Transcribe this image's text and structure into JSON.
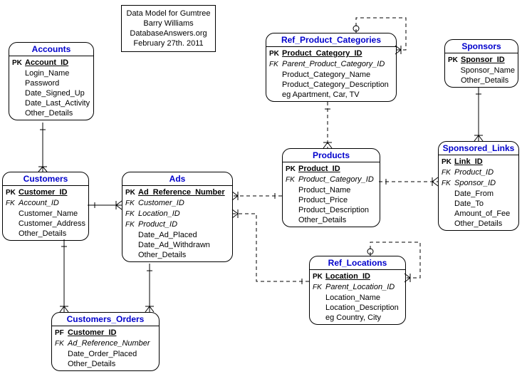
{
  "info": {
    "line1": "Data Model for Gumtree",
    "line2": "Barry Williams",
    "line3": "DatabaseAnswers.org",
    "line4": "February 27th. 2011"
  },
  "entities": {
    "accounts": {
      "title": "Accounts",
      "attrs": [
        {
          "key": "PK",
          "name": "Account_ID",
          "pk": true
        },
        {
          "key": "",
          "name": "Login_Name"
        },
        {
          "key": "",
          "name": "Password"
        },
        {
          "key": "",
          "name": "Date_Signed_Up"
        },
        {
          "key": "",
          "name": "Date_Last_Activity"
        },
        {
          "key": "",
          "name": "Other_Details"
        }
      ]
    },
    "customers": {
      "title": "Customers",
      "attrs": [
        {
          "key": "PK",
          "name": "Customer_ID",
          "pk": true
        },
        {
          "key": "FK",
          "name": "Account_ID",
          "fk": true
        },
        {
          "key": "",
          "name": "Customer_Name"
        },
        {
          "key": "",
          "name": "Customer_Address"
        },
        {
          "key": "",
          "name": "Other_Details"
        }
      ]
    },
    "ads": {
      "title": "Ads",
      "attrs": [
        {
          "key": "PK",
          "name": "Ad_Reference_Number",
          "pk": true
        },
        {
          "key": "FK",
          "name": "Customer_ID",
          "fk": true
        },
        {
          "key": "FK",
          "name": "Location_ID",
          "fk": true
        },
        {
          "key": "FK",
          "name": "Product_ID",
          "fk": true
        },
        {
          "key": "",
          "name": "Date_Ad_Placed"
        },
        {
          "key": "",
          "name": "Date_Ad_Withdrawn"
        },
        {
          "key": "",
          "name": "Other_Details"
        }
      ]
    },
    "customers_orders": {
      "title": "Customers_Orders",
      "attrs": [
        {
          "key": "PF",
          "name": "Customer_ID",
          "pk": true
        },
        {
          "key": "FK",
          "name": "Ad_Reference_Number",
          "fk": true
        },
        {
          "key": "",
          "name": "Date_Order_Placed"
        },
        {
          "key": "",
          "name": "Other_Details"
        }
      ]
    },
    "ref_product_categories": {
      "title": "Ref_Product_Categories",
      "attrs": [
        {
          "key": "PK",
          "name": "Product_Category_ID",
          "pk": true
        },
        {
          "key": "FK",
          "name": "Parent_Product_Category_ID",
          "fk": true
        },
        {
          "key": "",
          "name": "Product_Category_Name"
        },
        {
          "key": "",
          "name": "Product_Category_Description"
        },
        {
          "key": "",
          "name": "eg Apartment, Car, TV"
        }
      ]
    },
    "products": {
      "title": "Products",
      "attrs": [
        {
          "key": "PK",
          "name": "Product_ID",
          "pk": true
        },
        {
          "key": "FK",
          "name": "Product_Category_ID",
          "fk": true
        },
        {
          "key": "",
          "name": "Product_Name"
        },
        {
          "key": "",
          "name": "Product_Price"
        },
        {
          "key": "",
          "name": "Product_Description"
        },
        {
          "key": "",
          "name": "Other_Details"
        }
      ]
    },
    "ref_locations": {
      "title": "Ref_Locations",
      "attrs": [
        {
          "key": "PK",
          "name": "Location_ID",
          "pk": true
        },
        {
          "key": "FK",
          "name": "Parent_Location_ID",
          "fk": true
        },
        {
          "key": "",
          "name": "Location_Name"
        },
        {
          "key": "",
          "name": "Location_Description"
        },
        {
          "key": "",
          "name": "eg Country, City"
        }
      ]
    },
    "sponsors": {
      "title": "Sponsors",
      "attrs": [
        {
          "key": "PK",
          "name": "Sponsor_ID",
          "pk": true
        },
        {
          "key": "",
          "name": "Sponsor_Name"
        },
        {
          "key": "",
          "name": "Other_Details"
        }
      ]
    },
    "sponsored_links": {
      "title": "Sponsored_Links",
      "attrs": [
        {
          "key": "PK",
          "name": "Link_ID",
          "pk": true
        },
        {
          "key": "FK",
          "name": "Product_ID",
          "fk": true
        },
        {
          "key": "FK",
          "name": "Sponsor_ID",
          "fk": true
        },
        {
          "key": "",
          "name": "Date_From"
        },
        {
          "key": "",
          "name": "Date_To"
        },
        {
          "key": "",
          "name": "Amount_of_Fee"
        },
        {
          "key": "",
          "name": "Other_Details"
        }
      ]
    }
  }
}
